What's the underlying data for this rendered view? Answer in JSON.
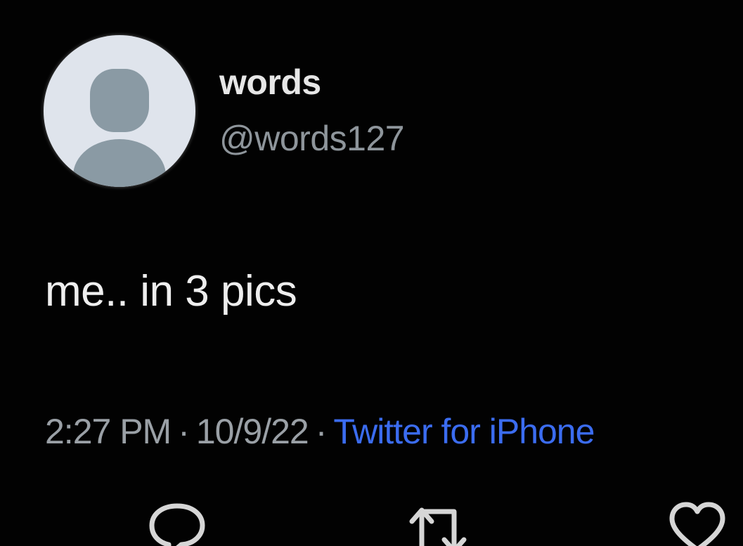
{
  "user": {
    "display_name": "words",
    "handle": "@words127",
    "avatar_icon": "default-profile-icon"
  },
  "tweet": {
    "text": "me.. in 3 pics",
    "time": "2:27 PM",
    "separator": "·",
    "date": "10/9/22",
    "source": "Twitter for iPhone"
  },
  "actions": {
    "reply_icon": "reply-icon",
    "retweet_icon": "retweet-icon",
    "like_icon": "heart-icon"
  },
  "colors": {
    "background": "#020202",
    "text": "#eeeeee",
    "muted": "#9aa0a6",
    "link": "#3b6cf0",
    "avatar_bg": "#dfe4ec",
    "avatar_figure": "#8a9aa4"
  }
}
